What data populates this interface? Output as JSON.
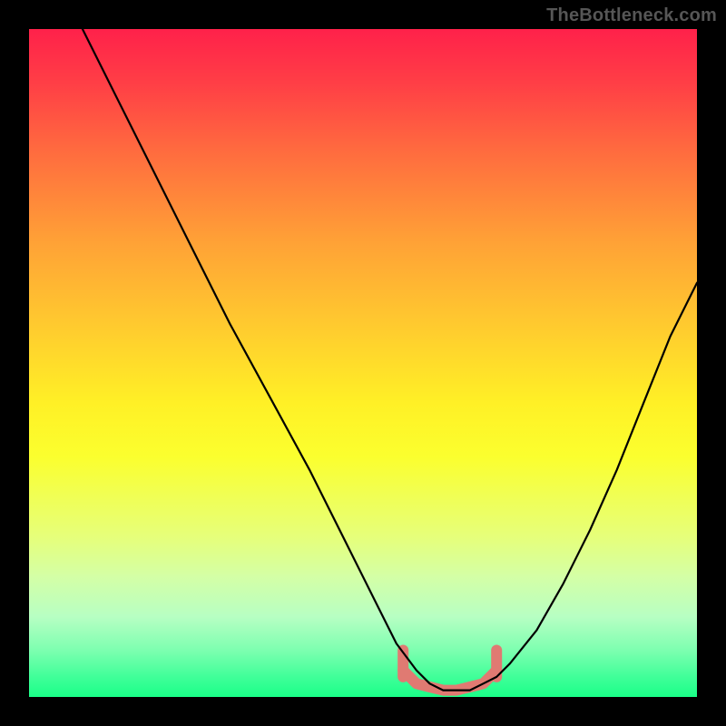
{
  "watermark": "TheBottleneck.com",
  "chart_data": {
    "type": "line",
    "title": "",
    "xlabel": "",
    "ylabel": "",
    "xlim": [
      0,
      100
    ],
    "ylim": [
      0,
      100
    ],
    "series": [
      {
        "name": "bottleneck-curve",
        "x": [
          8,
          12,
          18,
          24,
          30,
          36,
          42,
          48,
          52,
          55,
          58,
          60,
          62,
          64,
          66,
          68,
          70,
          72,
          76,
          80,
          84,
          88,
          92,
          96,
          100
        ],
        "y": [
          100,
          92,
          80,
          68,
          56,
          45,
          34,
          22,
          14,
          8,
          4,
          2,
          1,
          1,
          1,
          2,
          3,
          5,
          10,
          17,
          25,
          34,
          44,
          54,
          62
        ]
      },
      {
        "name": "optimal-zone-marker",
        "x": [
          56,
          58,
          60,
          62,
          64,
          66,
          68,
          70
        ],
        "y": [
          4,
          2,
          1.5,
          1,
          1,
          1.5,
          2,
          4
        ]
      }
    ],
    "colors": {
      "curve": "#000000",
      "marker": "#e07a72",
      "background_top": "#ff214a",
      "background_bottom": "#1aff88"
    }
  }
}
